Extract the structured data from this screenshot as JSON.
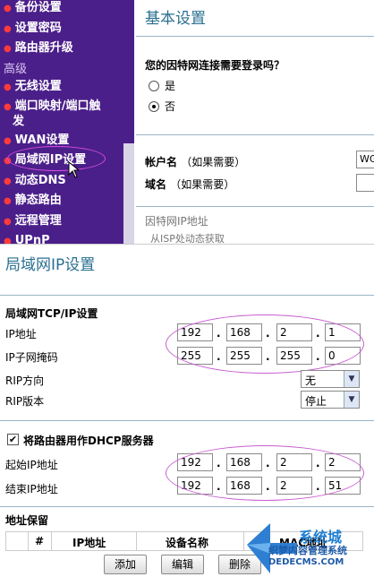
{
  "sidebar": {
    "items_top": [
      {
        "label": "备份设置"
      },
      {
        "label": "设置密码"
      },
      {
        "label": "路由器升级"
      }
    ],
    "heading": "高级",
    "items_adv": [
      {
        "label": "无线设置"
      },
      {
        "label": "端口映射/端口触"
      },
      {
        "label": "发"
      },
      {
        "label": "WAN设置"
      },
      {
        "label": "局域网IP设置"
      },
      {
        "label": "动态DNS"
      },
      {
        "label": "静态路由"
      },
      {
        "label": "远程管理"
      },
      {
        "label": "UPnP"
      }
    ]
  },
  "basic": {
    "title": "基本设置",
    "question": "您的因特网连接需要登录吗？",
    "radio_yes": "是",
    "radio_no": "否",
    "account_label": "帐户名",
    "account_hint": "（如果需要）",
    "account_value": "WG",
    "domain_label": "域名",
    "domain_hint": "（如果需要）",
    "section_cut": "因特网IP地址",
    "dhcp_cut": "从ISP处动态获取"
  },
  "lan": {
    "title": "局域网IP设置",
    "tcpip_section": "局域网TCP/IP设置",
    "ip_label": "IP地址",
    "ip": [
      "192",
      "168",
      "2",
      "1"
    ],
    "mask_label": "IP子网掩码",
    "mask": [
      "255",
      "255",
      "255",
      "0"
    ],
    "rip_dir_label": "RIP方向",
    "rip_dir_value": "无",
    "rip_ver_label": "RIP版本",
    "rip_ver_value": "停止",
    "dhcp_checkbox_label": "将路由器用作DHCP服务器",
    "start_label": "起始IP地址",
    "start_ip": [
      "192",
      "168",
      "2",
      "2"
    ],
    "end_label": "结束IP地址",
    "end_ip": [
      "192",
      "168",
      "2",
      "51"
    ],
    "reserve_section": "地址保留",
    "table_headers": {
      "num": "#",
      "ip": "IP地址",
      "device": "设备名称",
      "mac": "MAC地址"
    },
    "buttons": {
      "add": "添加",
      "edit": "编辑",
      "delete": "删除"
    }
  },
  "watermark": {
    "logo": "系统城",
    "text": "织梦内容管理系统",
    "url": "DEDECMS.COM"
  },
  "colors": {
    "sidebar_bg": "#4b1f8a",
    "title_color": "#2a6f8f",
    "highlight_ellipse": "#c85fd1"
  }
}
